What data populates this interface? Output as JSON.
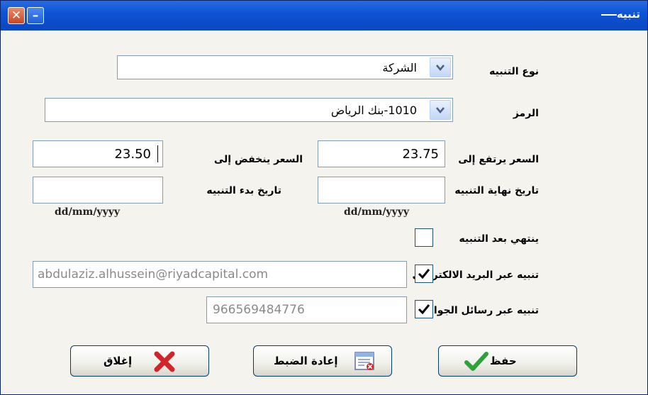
{
  "window": {
    "title": "تنبيه"
  },
  "form": {
    "alert_type": {
      "label": "نوع التنبيه",
      "value": "الشركة"
    },
    "symbol": {
      "label": "الرمز",
      "value": "1010-بنك الرياض"
    },
    "price_rise": {
      "label": "السعر يرتفع إلى",
      "value": "23.75"
    },
    "price_drop": {
      "label": "السعر ينخفض إلى",
      "value": "23.50"
    },
    "end_date": {
      "label": "تاريخ نهاية التنبيه",
      "value": "",
      "format": "dd/mm/yyyy"
    },
    "start_date": {
      "label": "تاريخ بدء التنبيه",
      "value": "",
      "format": "dd/mm/yyyy"
    },
    "expire_after_alert": {
      "label": "ينتهي بعد التنبيه",
      "checked": false
    },
    "email_alert": {
      "label": "تنبيه عبر البريد الالكتروني",
      "checked": true,
      "value": "abdulaziz.alhussein@riyadcapital.com"
    },
    "sms_alert": {
      "label": "تنبيه عبر رسائل الجوال",
      "checked": true,
      "value": "966569484776"
    }
  },
  "buttons": {
    "save": "حفظ",
    "reset": "إعادة الضبط",
    "close": "إغلاق"
  },
  "colors": {
    "titlebar": "#0f54d6",
    "client_bg": "#f4f3ee",
    "check_green": "#2ea23a",
    "close_red": "#d0262b",
    "field_border": "#7f9db9"
  }
}
